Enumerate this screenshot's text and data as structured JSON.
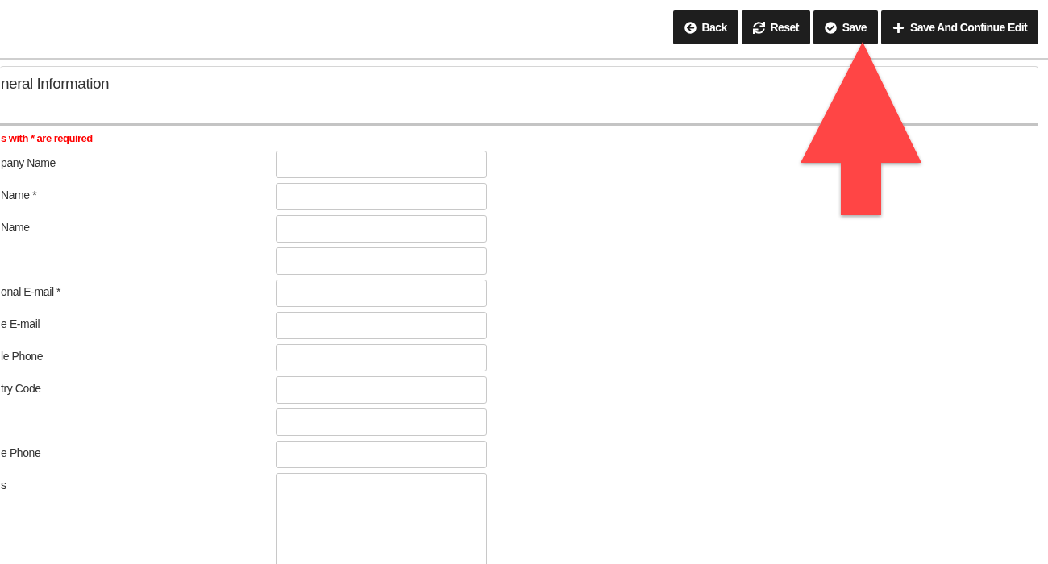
{
  "toolbar": [
    {
      "kind": "back",
      "label": "Back"
    },
    {
      "kind": "reset",
      "label": "Reset"
    },
    {
      "kind": "save",
      "label": "Save"
    },
    {
      "kind": "add",
      "label": "Save And Continue Edit"
    }
  ],
  "panel": {
    "title": "neral Information",
    "note": "s with * are required",
    "fields": [
      {
        "kind": "input",
        "label": "pany Name"
      },
      {
        "kind": "input",
        "label": "Name *"
      },
      {
        "kind": "input",
        "label": "Name"
      },
      {
        "kind": "input"
      },
      {
        "kind": "input",
        "label": "onal E-mail *"
      },
      {
        "kind": "input",
        "label": "e E-mail"
      },
      {
        "kind": "input",
        "label": "le Phone"
      },
      {
        "kind": "input",
        "label": "try Code"
      },
      {
        "kind": "input"
      },
      {
        "kind": "input",
        "label": "e Phone"
      },
      {
        "kind": "textarea",
        "label": "s"
      }
    ]
  },
  "callout": {
    "kind": "up-arrow"
  }
}
